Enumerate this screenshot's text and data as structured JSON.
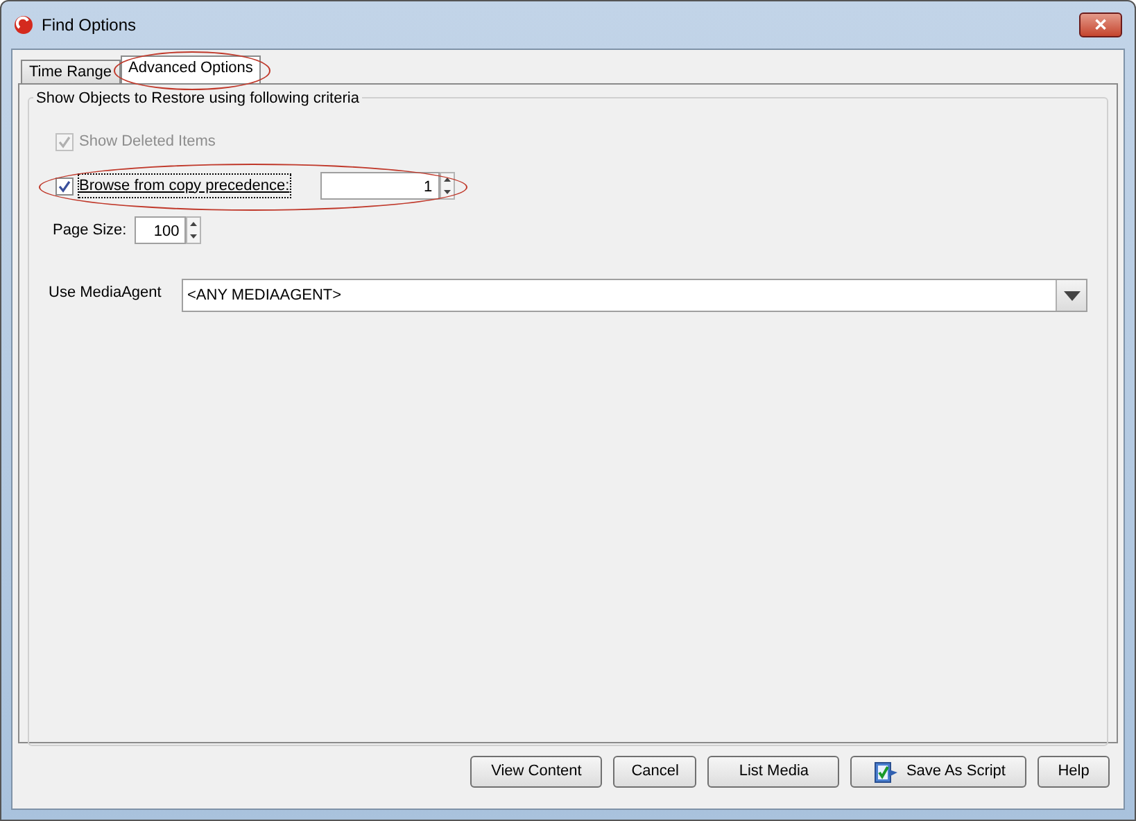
{
  "window": {
    "title": "Find Options",
    "close": "✕"
  },
  "tabs": [
    {
      "label": "Time Range",
      "selected": false,
      "highlighted": false
    },
    {
      "label": "Advanced Options",
      "selected": true,
      "highlighted": true
    }
  ],
  "group": {
    "title": "Show Objects to Restore using following criteria"
  },
  "options": [
    {
      "kind": "checkbox",
      "label": "Show Deleted Items",
      "checked": true,
      "disabled": true,
      "highlighted": false
    },
    {
      "kind": "checkbox-spinner",
      "label": "Browse from copy precedence:",
      "checked": true,
      "disabled": false,
      "highlighted": true,
      "value": "1"
    },
    {
      "kind": "spinner",
      "label": "Page Size:",
      "value": "100",
      "highlighted": false
    }
  ],
  "media_agent": {
    "label": "Use MediaAgent",
    "value": "<ANY MEDIAAGENT>"
  },
  "buttons": [
    {
      "label": "View Content",
      "kind": "plain"
    },
    {
      "label": "Cancel",
      "kind": "plain"
    },
    {
      "label": "List Media",
      "kind": "plain"
    },
    {
      "label": "Save As Script",
      "kind": "script"
    },
    {
      "label": "Help",
      "kind": "plain"
    }
  ]
}
